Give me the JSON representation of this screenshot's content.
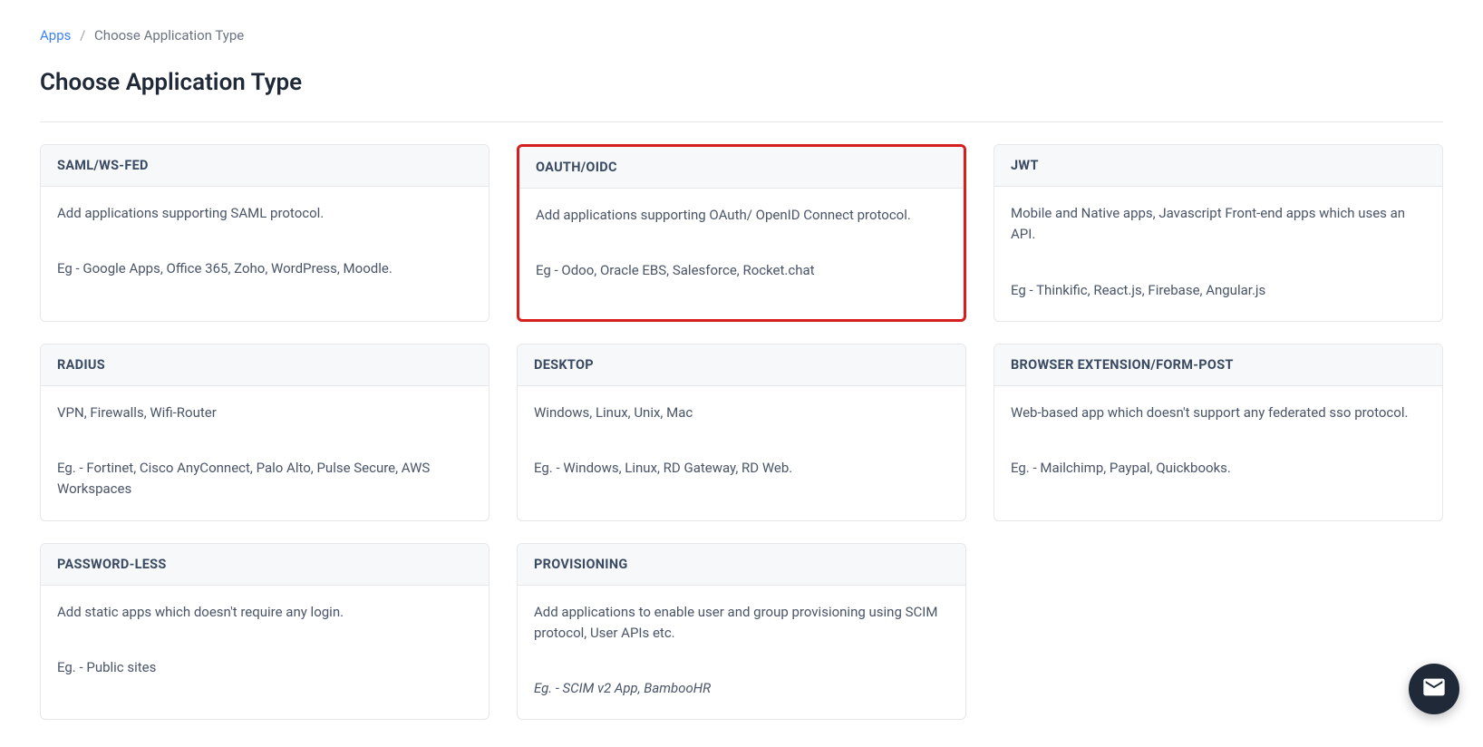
{
  "breadcrumb": {
    "root": "Apps",
    "current": "Choose Application Type"
  },
  "page_title": "Choose Application Type",
  "cards": [
    {
      "title": "SAML/WS-FED",
      "description": "Add applications supporting SAML protocol.",
      "example": "Eg - Google Apps, Office 365, Zoho, WordPress, Moodle.",
      "highlighted": false,
      "italic_example": false
    },
    {
      "title": "OAUTH/OIDC",
      "description": "Add applications supporting OAuth/ OpenID Connect protocol.",
      "example": "Eg - Odoo, Oracle EBS, Salesforce, Rocket.chat",
      "highlighted": true,
      "italic_example": false
    },
    {
      "title": "JWT",
      "description": "Mobile and Native apps, Javascript Front-end apps which uses an API.",
      "example": "Eg - Thinkific, React.js, Firebase, Angular.js",
      "highlighted": false,
      "italic_example": false
    },
    {
      "title": "RADIUS",
      "description": "VPN, Firewalls, Wifi-Router",
      "example": "Eg. - Fortinet, Cisco AnyConnect, Palo Alto, Pulse Secure, AWS Workspaces",
      "highlighted": false,
      "italic_example": false
    },
    {
      "title": "DESKTOP",
      "description": "Windows, Linux, Unix, Mac",
      "example": "Eg. - Windows, Linux, RD Gateway, RD Web.",
      "highlighted": false,
      "italic_example": false
    },
    {
      "title": "BROWSER EXTENSION/FORM-POST",
      "description": "Web-based app which doesn't support any federated sso protocol.",
      "example": "Eg. - Mailchimp, Paypal, Quickbooks.",
      "highlighted": false,
      "italic_example": false
    },
    {
      "title": "PASSWORD-LESS",
      "description": "Add static apps which doesn't require any login.",
      "example": "Eg. - Public sites",
      "highlighted": false,
      "italic_example": false
    },
    {
      "title": "PROVISIONING",
      "description": "Add applications to enable user and group provisioning using SCIM protocol, User APIs etc.",
      "example": "Eg. - SCIM v2 App, BambooHR",
      "highlighted": false,
      "italic_example": true
    }
  ]
}
